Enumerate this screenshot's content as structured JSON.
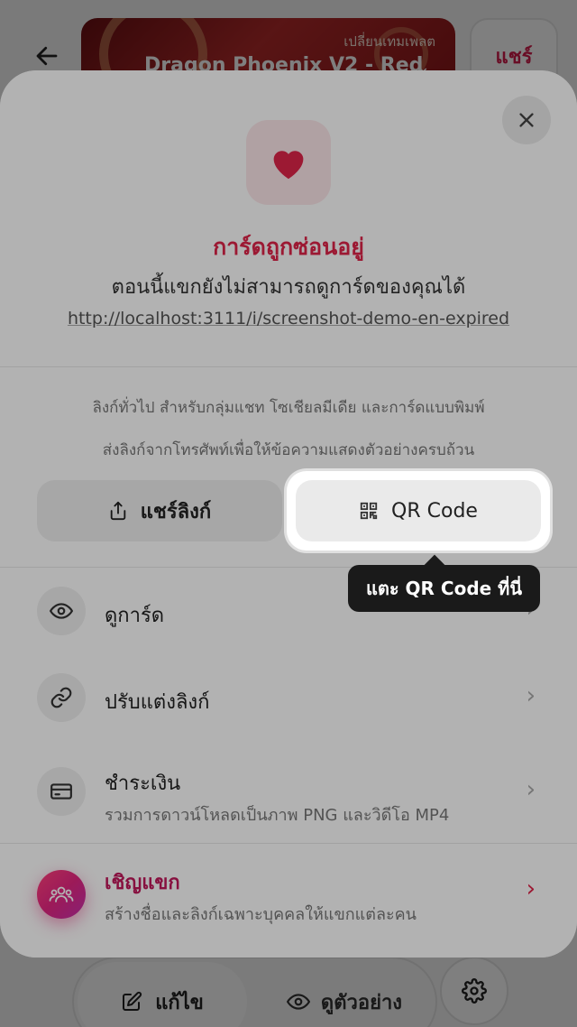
{
  "background": {
    "template": {
      "subtitle": "เปลี่ยนเทมเพลต",
      "name": "Dragon Phoenix V2 - Red"
    },
    "share_button": "แชร์",
    "bottom_bar": {
      "edit_label": "แก้ไข",
      "preview_label": "ดูตัวอย่าง"
    }
  },
  "sheet": {
    "status": {
      "title": "การ์ดถูกซ่อนอยู่",
      "description": "ตอนนี้แขกยังไม่สามารถดูการ์ดของคุณได้",
      "url": "http://localhost:3111/i/screenshot-demo-en-expired"
    },
    "share": {
      "hint_line1": "ลิงก์ทั่วไป สำหรับกลุ่มแชท โซเชียลมีเดีย และการ์ดแบบพิมพ์",
      "hint_line2": "ส่งลิงก์จากโทรศัพท์เพื่อให้ข้อความแสดงตัวอย่างครบถ้วน",
      "share_link_label": "แชร์ลิงก์",
      "qr_label": "QR Code"
    },
    "tooltip": "แตะ QR Code ที่นี่",
    "menu": [
      {
        "title": "ดูการ์ด",
        "subtitle": ""
      },
      {
        "title": "ปรับแต่งลิงก์",
        "subtitle": ""
      },
      {
        "title": "ชำระเงิน",
        "subtitle": "รวมการดาวน์โหลดเป็นภาพ PNG และวิดีโอ MP4"
      },
      {
        "title": "เชิญแขก",
        "subtitle": "สร้างชื่อและลิงก์เฉพาะบุคคลให้แขกแต่ละคน"
      }
    ]
  },
  "colors": {
    "accent": "#e0254a",
    "invite_gradient_start": "#ff3f7a",
    "invite_gradient_end": "#c22ea8"
  }
}
